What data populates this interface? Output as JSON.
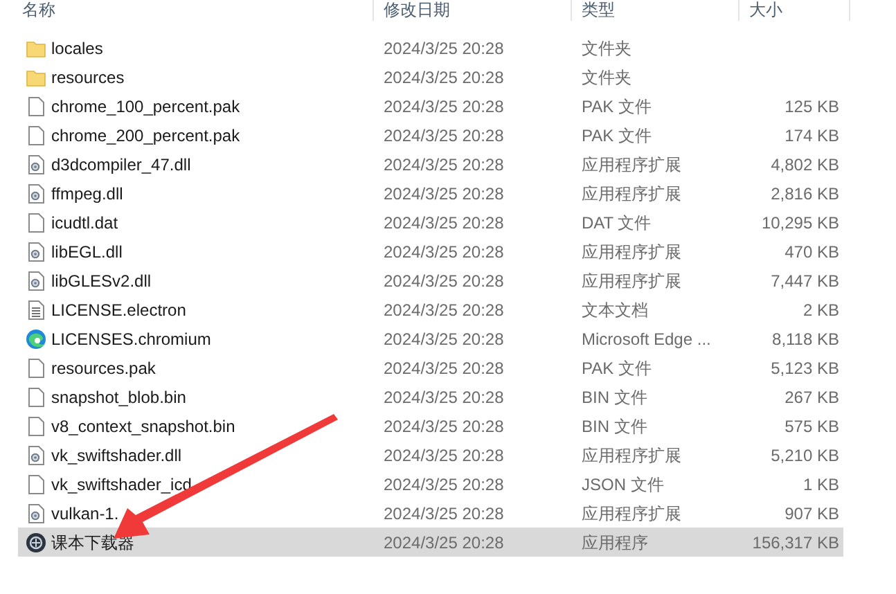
{
  "columns": [
    "名称",
    "修改日期",
    "类型",
    "大小"
  ],
  "rows": [
    {
      "kind": "folder",
      "name": "locales",
      "date": "2024/3/25 20:28",
      "type": "文件夹",
      "selected": false
    },
    {
      "kind": "folder",
      "name": "resources",
      "date": "2024/3/25 20:28",
      "type": "文件夹",
      "selected": false
    },
    {
      "kind": "file",
      "name": "chrome_100_percent.pak",
      "date": "2024/3/25 20:28",
      "type": "PAK 文件",
      "size": "125 KB",
      "selected": false
    },
    {
      "kind": "file",
      "name": "chrome_200_percent.pak",
      "date": "2024/3/25 20:28",
      "type": "PAK 文件",
      "size": "174 KB",
      "selected": false
    },
    {
      "kind": "dll",
      "name": "d3dcompiler_47.dll",
      "date": "2024/3/25 20:28",
      "type": "应用程序扩展",
      "size": "4,802 KB",
      "selected": false
    },
    {
      "kind": "dll",
      "name": "ffmpeg.dll",
      "date": "2024/3/25 20:28",
      "type": "应用程序扩展",
      "size": "2,816 KB",
      "selected": false
    },
    {
      "kind": "file",
      "name": "icudtl.dat",
      "date": "2024/3/25 20:28",
      "type": "DAT 文件",
      "size": "10,295 KB",
      "selected": false
    },
    {
      "kind": "dll",
      "name": "libEGL.dll",
      "date": "2024/3/25 20:28",
      "type": "应用程序扩展",
      "size": "470 KB",
      "selected": false
    },
    {
      "kind": "dll",
      "name": "libGLESv2.dll",
      "date": "2024/3/25 20:28",
      "type": "应用程序扩展",
      "size": "7,447 KB",
      "selected": false
    },
    {
      "kind": "text",
      "name": "LICENSE.electron",
      "date": "2024/3/25 20:28",
      "type": "文本文档",
      "size": "2 KB",
      "selected": false
    },
    {
      "kind": "edge",
      "name": "LICENSES.chromium",
      "date": "2024/3/25 20:28",
      "type": "Microsoft Edge ...",
      "size": "8,118 KB",
      "selected": false
    },
    {
      "kind": "file",
      "name": "resources.pak",
      "date": "2024/3/25 20:28",
      "type": "PAK 文件",
      "size": "5,123 KB",
      "selected": false
    },
    {
      "kind": "file",
      "name": "snapshot_blob.bin",
      "date": "2024/3/25 20:28",
      "type": "BIN 文件",
      "size": "267 KB",
      "selected": false
    },
    {
      "kind": "file",
      "name": "v8_context_snapshot.bin",
      "date": "2024/3/25 20:28",
      "type": "BIN 文件",
      "size": "575 KB",
      "selected": false
    },
    {
      "kind": "dll",
      "name": "vk_swiftshader.dll",
      "date": "2024/3/25 20:28",
      "type": "应用程序扩展",
      "size": "5,210 KB",
      "selected": false
    },
    {
      "kind": "file",
      "name": "vk_swiftshader_icd",
      "date": "2024/3/25 20:28",
      "type": "JSON 文件",
      "size": "1 KB",
      "selected": false
    },
    {
      "kind": "dll",
      "name": "vulkan-1.",
      "date": "2024/3/25 20:28",
      "type": "应用程序扩展",
      "size": "907 KB",
      "selected": false
    },
    {
      "kind": "app",
      "name": "课本下载器",
      "date": "2024/3/25 20:28",
      "type": "应用程序",
      "size": "156,317 KB",
      "selected": true
    }
  ]
}
